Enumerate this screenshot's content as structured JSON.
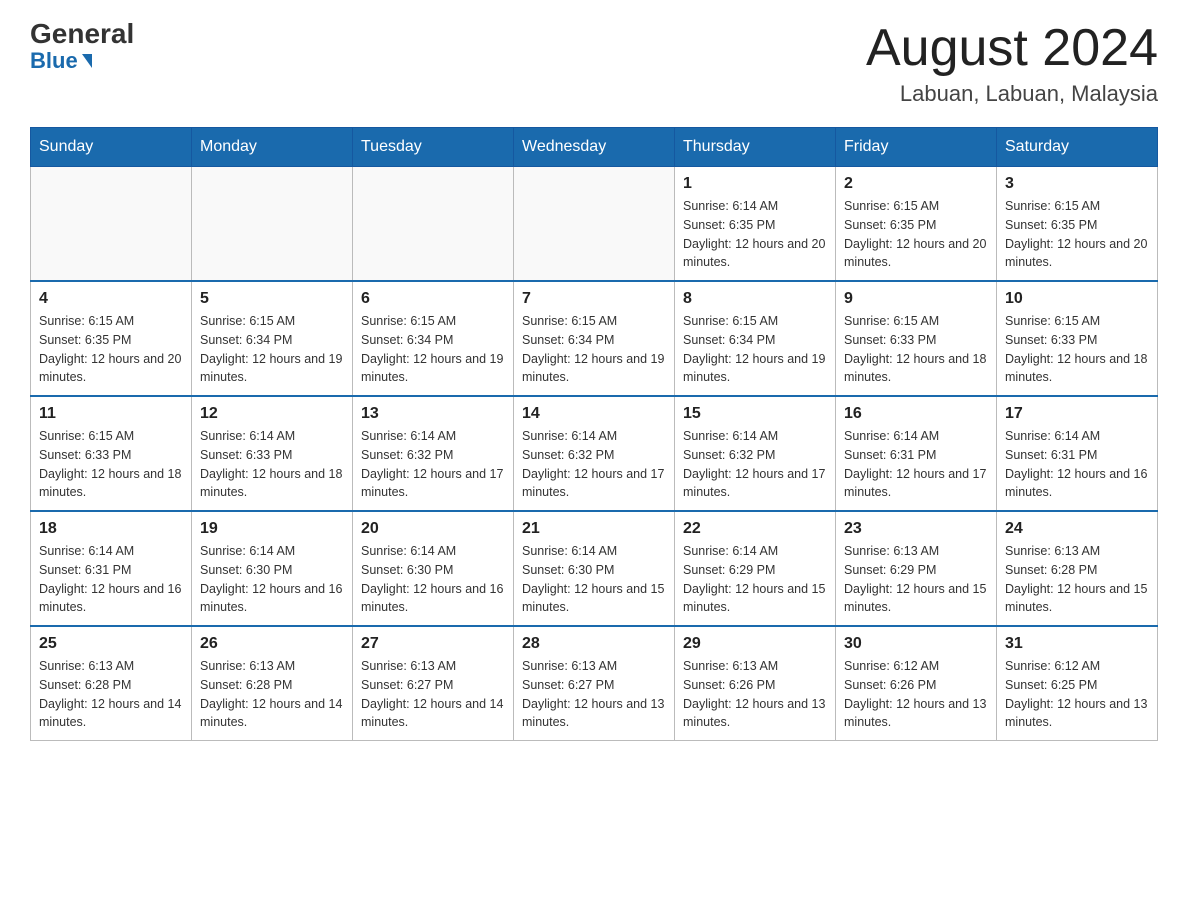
{
  "header": {
    "logo_general": "General",
    "logo_blue": "Blue",
    "month_title": "August 2024",
    "location": "Labuan, Labuan, Malaysia"
  },
  "days_of_week": [
    "Sunday",
    "Monday",
    "Tuesday",
    "Wednesday",
    "Thursday",
    "Friday",
    "Saturday"
  ],
  "weeks": [
    [
      {
        "num": "",
        "info": ""
      },
      {
        "num": "",
        "info": ""
      },
      {
        "num": "",
        "info": ""
      },
      {
        "num": "",
        "info": ""
      },
      {
        "num": "1",
        "info": "Sunrise: 6:14 AM\nSunset: 6:35 PM\nDaylight: 12 hours and 20 minutes."
      },
      {
        "num": "2",
        "info": "Sunrise: 6:15 AM\nSunset: 6:35 PM\nDaylight: 12 hours and 20 minutes."
      },
      {
        "num": "3",
        "info": "Sunrise: 6:15 AM\nSunset: 6:35 PM\nDaylight: 12 hours and 20 minutes."
      }
    ],
    [
      {
        "num": "4",
        "info": "Sunrise: 6:15 AM\nSunset: 6:35 PM\nDaylight: 12 hours and 20 minutes."
      },
      {
        "num": "5",
        "info": "Sunrise: 6:15 AM\nSunset: 6:34 PM\nDaylight: 12 hours and 19 minutes."
      },
      {
        "num": "6",
        "info": "Sunrise: 6:15 AM\nSunset: 6:34 PM\nDaylight: 12 hours and 19 minutes."
      },
      {
        "num": "7",
        "info": "Sunrise: 6:15 AM\nSunset: 6:34 PM\nDaylight: 12 hours and 19 minutes."
      },
      {
        "num": "8",
        "info": "Sunrise: 6:15 AM\nSunset: 6:34 PM\nDaylight: 12 hours and 19 minutes."
      },
      {
        "num": "9",
        "info": "Sunrise: 6:15 AM\nSunset: 6:33 PM\nDaylight: 12 hours and 18 minutes."
      },
      {
        "num": "10",
        "info": "Sunrise: 6:15 AM\nSunset: 6:33 PM\nDaylight: 12 hours and 18 minutes."
      }
    ],
    [
      {
        "num": "11",
        "info": "Sunrise: 6:15 AM\nSunset: 6:33 PM\nDaylight: 12 hours and 18 minutes."
      },
      {
        "num": "12",
        "info": "Sunrise: 6:14 AM\nSunset: 6:33 PM\nDaylight: 12 hours and 18 minutes."
      },
      {
        "num": "13",
        "info": "Sunrise: 6:14 AM\nSunset: 6:32 PM\nDaylight: 12 hours and 17 minutes."
      },
      {
        "num": "14",
        "info": "Sunrise: 6:14 AM\nSunset: 6:32 PM\nDaylight: 12 hours and 17 minutes."
      },
      {
        "num": "15",
        "info": "Sunrise: 6:14 AM\nSunset: 6:32 PM\nDaylight: 12 hours and 17 minutes."
      },
      {
        "num": "16",
        "info": "Sunrise: 6:14 AM\nSunset: 6:31 PM\nDaylight: 12 hours and 17 minutes."
      },
      {
        "num": "17",
        "info": "Sunrise: 6:14 AM\nSunset: 6:31 PM\nDaylight: 12 hours and 16 minutes."
      }
    ],
    [
      {
        "num": "18",
        "info": "Sunrise: 6:14 AM\nSunset: 6:31 PM\nDaylight: 12 hours and 16 minutes."
      },
      {
        "num": "19",
        "info": "Sunrise: 6:14 AM\nSunset: 6:30 PM\nDaylight: 12 hours and 16 minutes."
      },
      {
        "num": "20",
        "info": "Sunrise: 6:14 AM\nSunset: 6:30 PM\nDaylight: 12 hours and 16 minutes."
      },
      {
        "num": "21",
        "info": "Sunrise: 6:14 AM\nSunset: 6:30 PM\nDaylight: 12 hours and 15 minutes."
      },
      {
        "num": "22",
        "info": "Sunrise: 6:14 AM\nSunset: 6:29 PM\nDaylight: 12 hours and 15 minutes."
      },
      {
        "num": "23",
        "info": "Sunrise: 6:13 AM\nSunset: 6:29 PM\nDaylight: 12 hours and 15 minutes."
      },
      {
        "num": "24",
        "info": "Sunrise: 6:13 AM\nSunset: 6:28 PM\nDaylight: 12 hours and 15 minutes."
      }
    ],
    [
      {
        "num": "25",
        "info": "Sunrise: 6:13 AM\nSunset: 6:28 PM\nDaylight: 12 hours and 14 minutes."
      },
      {
        "num": "26",
        "info": "Sunrise: 6:13 AM\nSunset: 6:28 PM\nDaylight: 12 hours and 14 minutes."
      },
      {
        "num": "27",
        "info": "Sunrise: 6:13 AM\nSunset: 6:27 PM\nDaylight: 12 hours and 14 minutes."
      },
      {
        "num": "28",
        "info": "Sunrise: 6:13 AM\nSunset: 6:27 PM\nDaylight: 12 hours and 13 minutes."
      },
      {
        "num": "29",
        "info": "Sunrise: 6:13 AM\nSunset: 6:26 PM\nDaylight: 12 hours and 13 minutes."
      },
      {
        "num": "30",
        "info": "Sunrise: 6:12 AM\nSunset: 6:26 PM\nDaylight: 12 hours and 13 minutes."
      },
      {
        "num": "31",
        "info": "Sunrise: 6:12 AM\nSunset: 6:25 PM\nDaylight: 12 hours and 13 minutes."
      }
    ]
  ]
}
